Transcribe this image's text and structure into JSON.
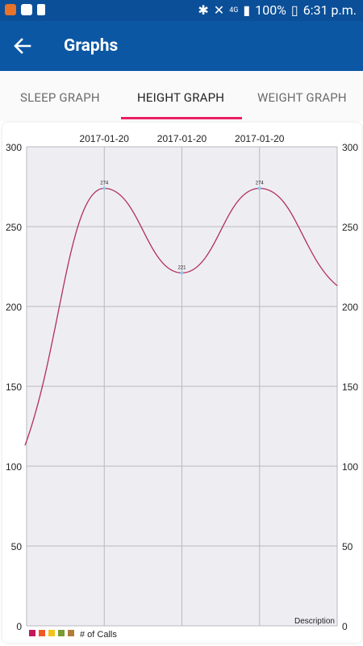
{
  "status_bar": {
    "battery": "100%",
    "time": "6:31 p.m.",
    "network": "4G"
  },
  "app_bar": {
    "title": "Graphs"
  },
  "tabs": [
    {
      "label": "SLEEP GRAPH"
    },
    {
      "label": "HEIGHT GRAPH"
    },
    {
      "label": "WEIGHT GRAPH"
    }
  ],
  "colors": {
    "app_bar": "#0b57a4",
    "tab_indicator": "#e91e63",
    "line": "#b0305a",
    "plot_bg": "#eeedf2"
  },
  "chart_data": {
    "type": "line",
    "top_labels": [
      "2017-01-20",
      "2017-01-20",
      "2017-01-20"
    ],
    "points": [
      {
        "x": 0,
        "y": 113
      },
      {
        "x": 1,
        "y": 274,
        "label": "274"
      },
      {
        "x": 2,
        "y": 221,
        "label": "221"
      },
      {
        "x": 3,
        "y": 274,
        "label": "274"
      },
      {
        "x": 4,
        "y": 213
      }
    ],
    "yticks_left": [
      "300",
      "250",
      "200",
      "150",
      "100",
      "50",
      "0"
    ],
    "yticks_right": [
      "300",
      "250",
      "200",
      "150",
      "100",
      "50",
      "0"
    ],
    "ylim": [
      0,
      300
    ],
    "description": "Description",
    "legend": {
      "label": "# of Calls",
      "colors": [
        "#c2185b",
        "#f05a22",
        "#f2c318",
        "#7a9a32",
        "#b07d3a"
      ]
    }
  }
}
